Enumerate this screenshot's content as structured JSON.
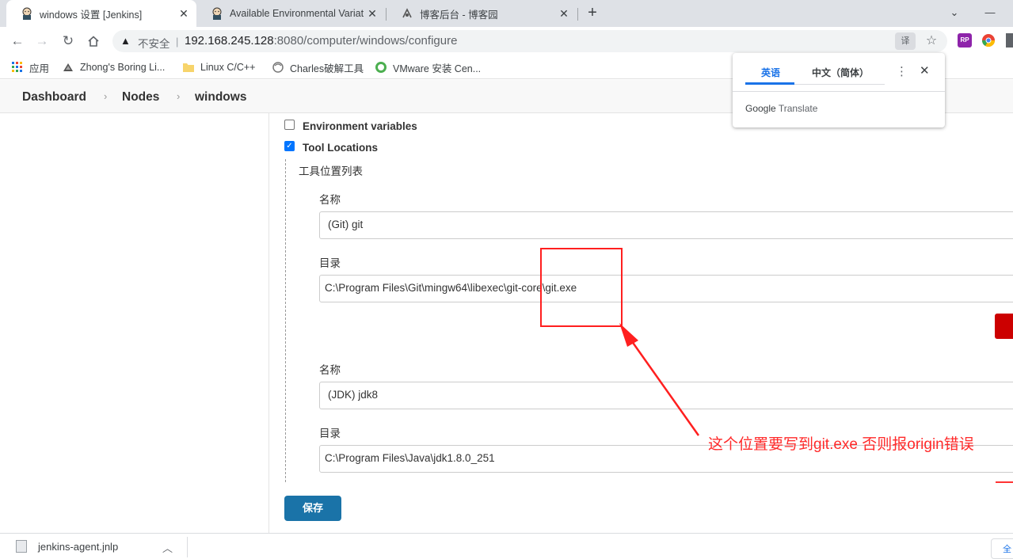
{
  "browser": {
    "tabs": [
      {
        "title": "windows 设置 [Jenkins]",
        "icon": "jenkins-icon",
        "active": true
      },
      {
        "title": "Available Environmental Variat",
        "icon": "jenkins-icon",
        "active": false
      },
      {
        "title": "博客后台 - 博客园",
        "icon": "cnblogs-icon",
        "active": false
      }
    ],
    "new_tab": "+",
    "window_controls": {
      "minimize": "—",
      "dropdown": "⌄"
    },
    "address": {
      "security_label": "不安全",
      "host": "192.168.245.128",
      "path": ":8080/computer/windows/configure"
    },
    "bookmarks": [
      {
        "label": "应用",
        "icon": "apps-grid-icon"
      },
      {
        "label": "Zhong's Boring Li...",
        "icon": "site-icon"
      },
      {
        "label": "Linux C/C++",
        "icon": "folder-icon"
      },
      {
        "label": "Charles破解工具",
        "icon": "site-icon"
      },
      {
        "label": "VMware 安装 Cen...",
        "icon": "site-icon"
      }
    ]
  },
  "translate_popup": {
    "tab_source": "英语",
    "tab_target": "中文（简体）",
    "brand_google": "Google",
    "brand_translate": "Translate"
  },
  "jenkins": {
    "breadcrumbs": [
      "Dashboard",
      "Nodes",
      "windows"
    ],
    "options": [
      {
        "label": "Environment variables",
        "checked": false
      },
      {
        "label": "Tool Locations",
        "checked": true
      }
    ],
    "tool_locations_title": "工具位置列表",
    "tools": [
      {
        "name_label": "名称",
        "name_value": "(Git) git",
        "dir_label": "目录",
        "dir_value": "C:\\Program Files\\Git\\mingw64\\libexec\\git-core\\git.exe"
      },
      {
        "name_label": "名称",
        "name_value": "(JDK) jdk8",
        "dir_label": "目录",
        "dir_value": "C:\\Program Files\\Java\\jdk1.8.0_251"
      }
    ],
    "save_label": "保存"
  },
  "annotation": {
    "text": "这个位置要写到git.exe  否则报origin错误",
    "color": "#ff2a2a"
  },
  "downloads": {
    "file": "jenkins-agent.jnlp",
    "show_all": "全"
  }
}
